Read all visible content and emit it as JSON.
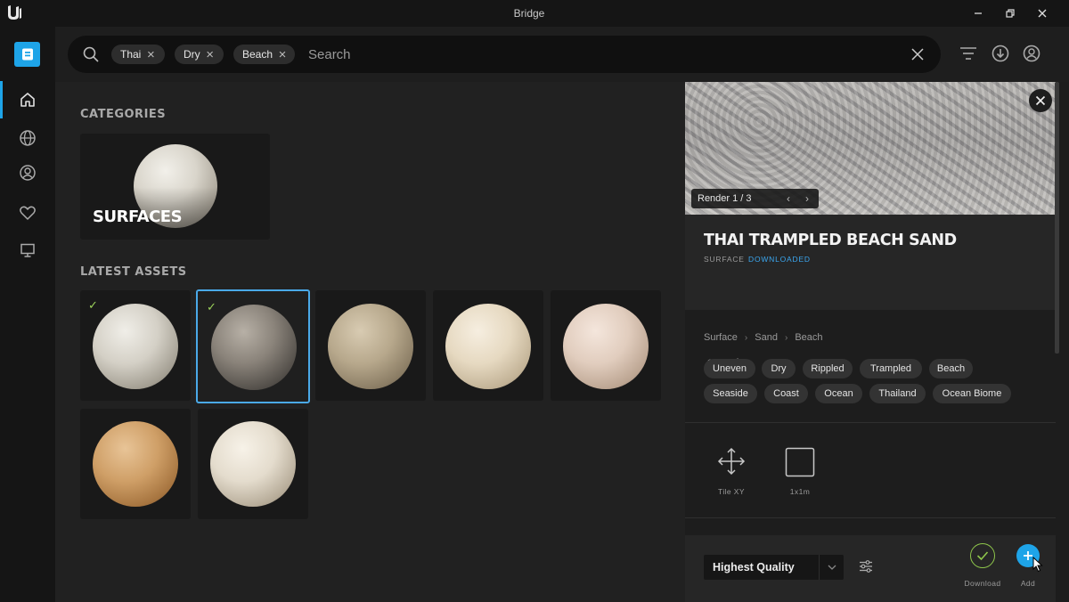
{
  "window": {
    "title": "Bridge"
  },
  "search": {
    "placeholder": "Search",
    "chips": [
      {
        "label": "Thai"
      },
      {
        "label": "Dry"
      },
      {
        "label": "Beach"
      }
    ]
  },
  "main": {
    "categories_title": "CATEGORIES",
    "category": {
      "label": "SURFACES"
    },
    "latest_title": "LATEST ASSETS",
    "assets": [
      {
        "downloaded": true,
        "selected": false
      },
      {
        "downloaded": true,
        "selected": true
      },
      {
        "downloaded": false,
        "selected": false
      },
      {
        "downloaded": false,
        "selected": false
      },
      {
        "downloaded": false,
        "selected": false
      },
      {
        "downloaded": false,
        "selected": false
      },
      {
        "downloaded": false,
        "selected": false
      }
    ]
  },
  "detail": {
    "render_label": "Render 1 / 3",
    "title": "THAI TRAMPLED BEACH SAND",
    "type": "SURFACE",
    "status": "DOWNLOADED",
    "breadcrumb": [
      "Surface",
      "Sand",
      "Beach"
    ],
    "tags": [
      "Uneven",
      "Dry",
      "Rippled",
      "Trampled",
      "Beach",
      "Seaside",
      "Coast",
      "Ocean",
      "Thailand",
      "Ocean Biome"
    ],
    "specs": [
      {
        "label": "Tile XY",
        "icon": "move-arrows-icon"
      },
      {
        "label": "1x1m",
        "icon": "square-icon"
      }
    ],
    "quality": "Highest Quality",
    "download_label": "Download",
    "add_label": "Add"
  },
  "colors": {
    "accent": "#1ea4e8",
    "downloaded": "#3ba7f0",
    "check": "#9bd15a"
  }
}
